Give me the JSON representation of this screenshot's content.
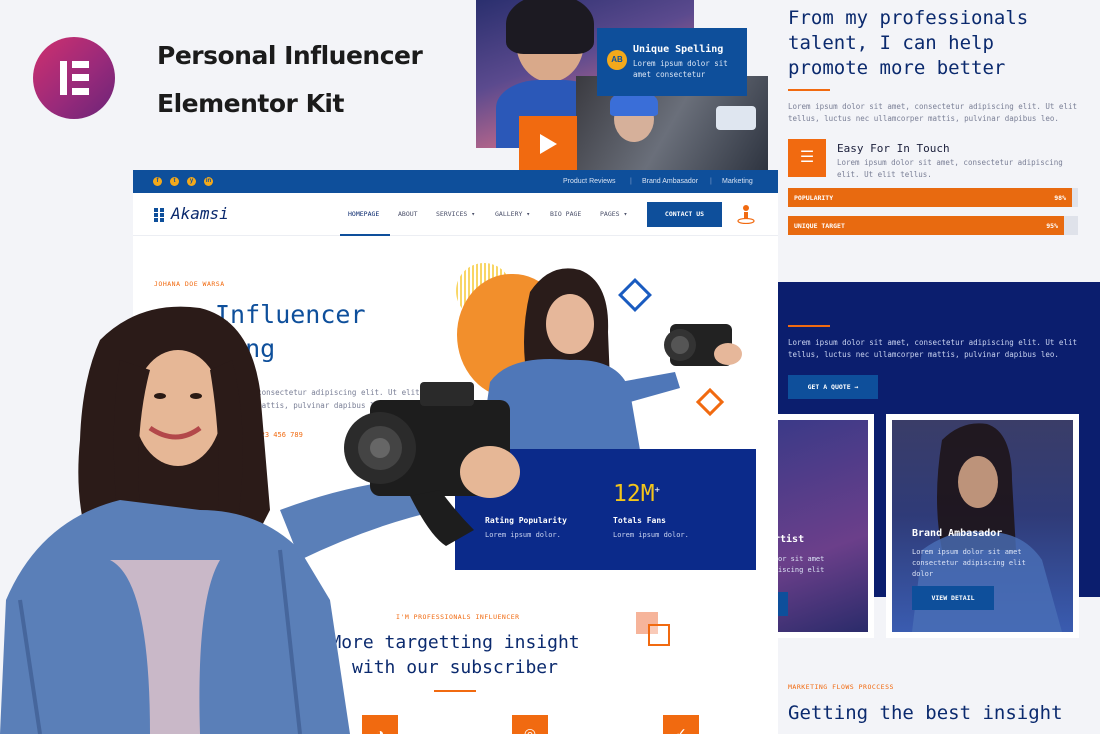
{
  "kit": {
    "title_line1": "Personal Influencer",
    "title_line2": "Elementor Kit",
    "logo_icon": "elementor-icon",
    "brand_colors": {
      "elementor": "#9a2a7a",
      "primary": "#0e4f9b",
      "navy": "#0b1e6e",
      "accent": "#f16a10",
      "yellow": "#f3c51b"
    }
  },
  "spelling_card": {
    "icon": "AB",
    "title": "Unique Spelling",
    "desc_line1": "Lorem ipsum dolor sit",
    "desc_line2": "amet consectetur"
  },
  "right_top": {
    "headline_line1": "From my professionals",
    "headline_line2": "talent, I can help",
    "headline_line3": "promote more better",
    "lorem_line1": "Lorem ipsum dolor sit amet, consectetur adipiscing elit. Ut elit",
    "lorem_line2": "tellus, luctus nec ullamcorper mattis, pulvinar dapibus leo.",
    "easy_title": "Easy For In Touch",
    "easy_desc_line1": "Lorem ipsum dolor sit amet, consectetur adipiscing",
    "easy_desc_line2": "elit. Ut elit tellus.",
    "bars": [
      {
        "label": "POPULARITY",
        "value_text": "98%",
        "value": 0.98
      },
      {
        "label": "UNIQUE TARGET",
        "value_text": "95%",
        "value": 0.95
      }
    ]
  },
  "site": {
    "social_icons": [
      "f",
      "t",
      "y",
      "in"
    ],
    "top_links": [
      "Product Reviews",
      "Brand Ambasador",
      "Marketing"
    ],
    "brand": "Akamsi",
    "nav": [
      "HOMEPAGE",
      "ABOUT",
      "SERVICES ▾",
      "GALLERY ▾",
      "BIO PAGE",
      "PAGES ▾"
    ],
    "contact_label": "CONTACT US",
    "hero_sub": "JOHANA DOE WARSA",
    "hero_title_line1": "Influencer",
    "hero_title_line2": "ting",
    "hero_lorem_line1": "amet, consectetur adipiscing elit. Ut elit",
    "hero_lorem_line2": "orper mattis, pulvinar dapibus leo.",
    "hero_phone": "123 456 789",
    "stats": [
      {
        "num": "",
        "label": "Rating Popularity",
        "desc": "Lorem ipsum dolor."
      },
      {
        "num": "12M",
        "sup": "+",
        "label": "Totals Fans",
        "desc": "Lorem ipsum dolor."
      }
    ],
    "section_sub": "I'M PROFESSIONALS INFLUENCER",
    "section_title_line1": "More targetting insight",
    "section_title_line2": "with our subscriber"
  },
  "right_panel": {
    "lorem_line1": "Lorem ipsum dolor sit amet, consectetur adipiscing elit. Ut elit",
    "lorem_line2": "tellus, luctus nec ullamcorper mattis, pulvinar dapibus leo.",
    "quote_label": "GET A QUOTE →",
    "card_left_title": "rtist",
    "card_left_desc_line1": "or sit amet",
    "card_left_desc_line2": "iscing elit",
    "card_right_title": "Brand Ambasador",
    "card_right_desc_line1": "Lorem ipsum dolor sit amet",
    "card_right_desc_line2": "consectetur adipiscing elit",
    "card_right_desc_line3": "dolor",
    "view_label": "VIEW DETAIL",
    "bottom_sub": "MARKETING FLOWS PROCCESS",
    "bottom_title_line1": "Getting the best insight"
  }
}
